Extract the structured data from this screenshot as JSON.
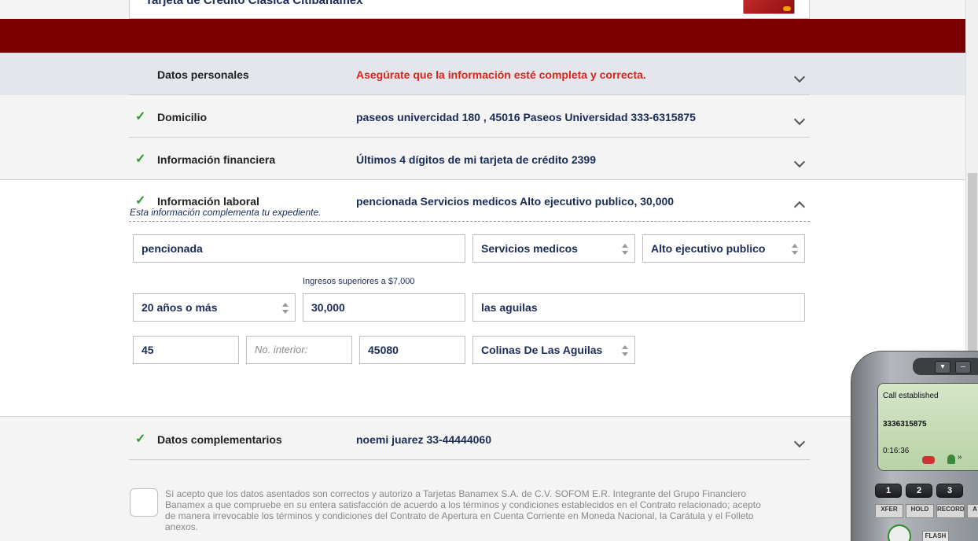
{
  "header": {
    "card_title": "Tarjeta de Crédito Clásica Citibanamex"
  },
  "sections": {
    "personal": {
      "label": "Datos personales",
      "value": "Asegúrate que la información esté completa y correcta."
    },
    "domicilio": {
      "label": "Domicilio",
      "value": "paseos univercidad 180 , 45016 Paseos Universidad 333-6315875"
    },
    "financiera": {
      "label": "Información financiera",
      "value": "Últimos 4 dígitos de mi tarjeta de crédito 2399"
    },
    "laboral": {
      "label": "Información laboral",
      "value": "pencionada Servicios medicos Alto ejecutivo publico, 30,000",
      "subtitle": "Esta información complementa tu expediente."
    },
    "complementarios": {
      "label": "Datos complementarios",
      "value": "noemi juarez 33-44444060"
    }
  },
  "form": {
    "empresa": "pencionada",
    "giro": "Servicios medicos",
    "puesto": "Alto ejecutivo publico",
    "ingresos_label": "Ingresos superiores a $7,000",
    "antiguedad": "20 años o más",
    "ingresos": "30,000",
    "calle": "las aguilas",
    "no_exterior": "45",
    "no_interior_placeholder": "No. interior:",
    "cp": "45080",
    "colonia": "Colinas De Las Aguilas"
  },
  "consent": {
    "text": "Sí acepto que los datos asentados son correctos y autorizo a Tarjetas Banamex S.A. de C.V. SOFOM E.R. Integrante del Grupo Financiero Banamex a que compruebe en su entera satisfacción de acuerdo a los términos y condiciones establecidos en el Contrato relacionado; acepto de manera irrevocable los términos y condiciones del Contrato de Apertura en Cuenta Corriente en Moneda Nacional, la Carátula y el Folleto anexos."
  },
  "softphone": {
    "status": "Call established",
    "number": "3336315875",
    "timer": "0:16:36",
    "keys": [
      "1",
      "2",
      "3"
    ],
    "fkeys": [
      "XFER",
      "HOLD",
      "RECORD",
      "A"
    ],
    "flash": "FLASH"
  },
  "colors": {
    "brand_red": "#7b0000",
    "warning_red": "#d9261c",
    "text_navy": "#1a2b57",
    "check_green": "#2a9a2a"
  }
}
